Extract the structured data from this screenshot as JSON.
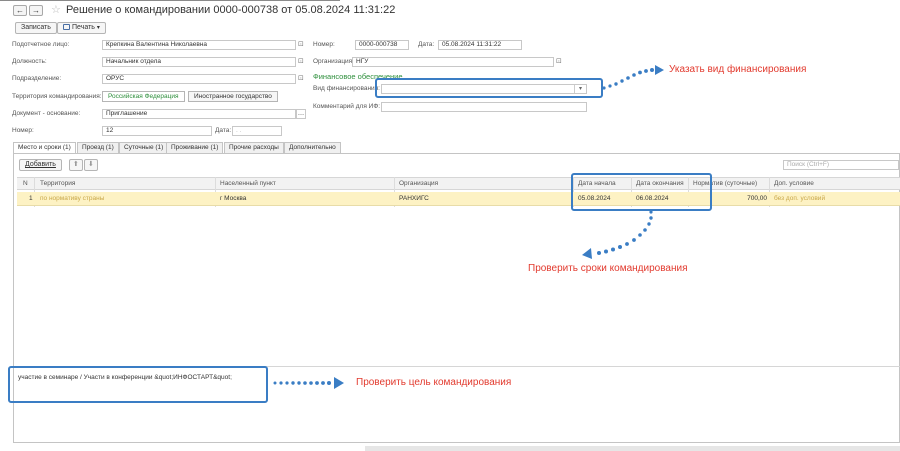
{
  "window": {
    "back_glyph": "←",
    "forward_glyph": "→",
    "star_glyph": "☆",
    "title": "Решение о командировании 0000-000738 от 05.08.2024 11:31:22"
  },
  "toolbar": {
    "save_label": "Записать",
    "print_label": "Печать",
    "dropdown_glyph": "▾"
  },
  "form": {
    "person_label": "Подотчетное лицо:",
    "person_value": "Крепкина Валентина Николаевна",
    "position_label": "Должность:",
    "position_value": "Начальник отдела",
    "department_label": "Подразделение:",
    "department_value": "ОРУС",
    "territory_label": "Территория командирования:",
    "territory_options": [
      "Российская Федерация",
      "Иностранное государство"
    ],
    "basis_label": "Документ - основание:",
    "basis_value": "Приглашение",
    "number2_label": "Номер:",
    "number2_value": "12",
    "date2_label": "Дата:",
    "date2_placeholder": ". .",
    "number_label": "Номер:",
    "number_value": "0000-000738",
    "date_label": "Дата:",
    "date_value": "05.08.2024 11:31:22",
    "org_label": "Организация:",
    "org_value": "НГУ",
    "finance_header": "Финансовое обеспечение",
    "finance_type_label": "Вид финансирования:",
    "finance_type_value": "",
    "comment_label": "Комментарий для ИФ:",
    "comment_value": "",
    "open_glyph": "⊡",
    "select_glyph": "…"
  },
  "tabs": [
    "Место и сроки (1)",
    "Проезд (1)",
    "Суточные (1)",
    "Проживание (1)",
    "Прочие расходы",
    "Дополнительно"
  ],
  "table_toolbar": {
    "add_label": "Добавить",
    "up_glyph": "⬆",
    "down_glyph": "⬇",
    "search_placeholder": "Поиск (Ctrl+F)"
  },
  "table": {
    "columns": [
      "N",
      "Территория",
      "Населенный пункт",
      "Организация",
      "Дата начала",
      "Дата окончания",
      "Норматив (суточные)",
      "Доп. условие"
    ],
    "rows": [
      [
        "1",
        "по нормативу страны",
        "г Москва",
        "РАНХИГС",
        "05.08.2024",
        "06.08.2024",
        "700,00",
        "без доп. условий"
      ]
    ]
  },
  "purpose": {
    "text": "участие в семинаре / Участи в конференции &quot;ИНФОСТАРТ&quot;"
  },
  "annotations": {
    "finance": "Указать вид финансирования",
    "dates": "Проверить сроки командирования",
    "purpose": "Проверить цель командирования"
  },
  "colors": {
    "accent_green": "#2e8f3c",
    "highlight_blue": "#3a7dc4",
    "callout_red": "#e23a2e",
    "row_highlight": "#fdf2c4"
  }
}
